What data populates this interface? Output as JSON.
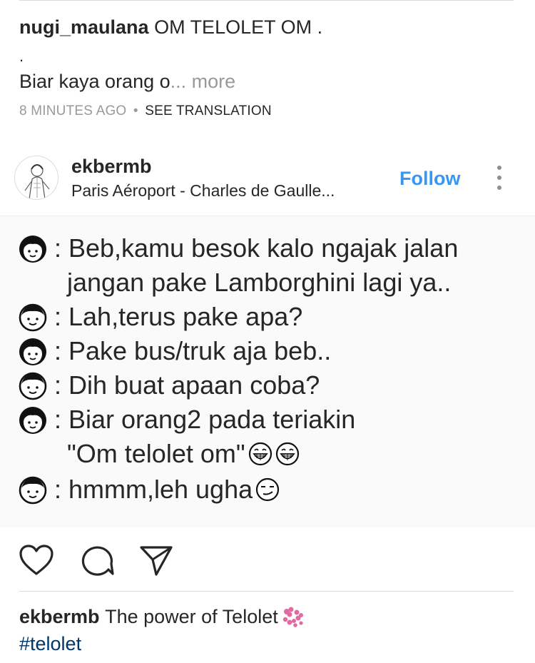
{
  "previous_post": {
    "username": "nugi_maulana",
    "caption_title": "OM TELOLET OM .",
    "caption_dot": ".",
    "caption_preview": "Biar kaya orang o",
    "more_label": "... more",
    "timestamp": "8 MINUTES AGO",
    "separator": "•",
    "translation_label": "SEE TRANSLATION"
  },
  "post": {
    "author": "ekbermb",
    "location": "Paris Aéroport - Charles de Gaulle...",
    "follow_label": "Follow",
    "menu_icon": "more-vertical-icon",
    "image_text": {
      "line1": ": Beb,kamu besok kalo ngajak jalan",
      "line1b": "jangan pake Lamborghini lagi ya..",
      "line2": ": Lah,terus pake apa?",
      "line3": ": Pake bus/truk aja beb..",
      "line4": ": Dih buat apaan coba?",
      "line5": ": Biar orang2 pada teriakin",
      "line5b": "\"Om telolet om\"",
      "line6": ":  hmmm,leh ugha"
    },
    "actions": {
      "like_icon": "heart-icon",
      "comment_icon": "comment-icon",
      "share_icon": "share-icon"
    },
    "caption": {
      "username": "ekbermb",
      "text": "The power of Telolet",
      "hashtag": "#telolet"
    }
  },
  "colors": {
    "link_blue": "#3897f0",
    "hashtag_blue": "#003569",
    "meta_gray": "#999999",
    "text": "#262626"
  }
}
